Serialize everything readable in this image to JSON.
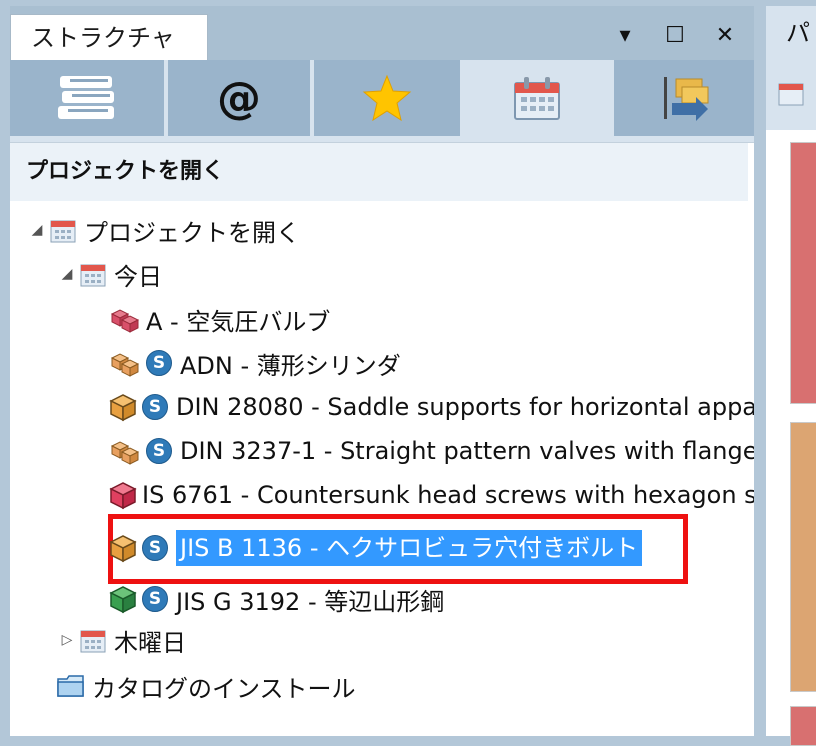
{
  "panel": {
    "title": "ストラクチャ",
    "window_controls": [
      "▾",
      "☐",
      "✕"
    ]
  },
  "toolbar": {
    "buttons": [
      {
        "icon": "books-icon"
      },
      {
        "icon": "at-icon",
        "label": "@"
      },
      {
        "icon": "star-icon"
      },
      {
        "icon": "calendar-icon"
      },
      {
        "icon": "import-icon"
      }
    ]
  },
  "section_header": "プロジェクトを開く",
  "tree": {
    "root": {
      "label": "プロジェクトを開く"
    },
    "today": {
      "label": "今日"
    },
    "items": [
      {
        "label": "A - 空気圧バルブ",
        "cube_color": "#d8506a",
        "has_s": false
      },
      {
        "label": "ADN - 薄形シリンダ",
        "cube_color": "#e8a060",
        "has_s": true
      },
      {
        "label": "DIN 28080 - Saddle supports for horizontal appa",
        "cube_color": "#e8a040",
        "has_s": true
      },
      {
        "label": "DIN 3237-1 - Straight pattern valves with flange",
        "cube_color": "#e8a060",
        "has_s": true
      },
      {
        "label": "IS 6761 - Countersunk head screws with hexagon s",
        "cube_color": "#e04060",
        "has_s": false
      },
      {
        "label": "JIS B 1136 - ヘクサロビュラ穴付きボルト",
        "cube_color": "#e8a040",
        "has_s": true,
        "selected": true
      },
      {
        "label": "JIS G 3192 - 等辺山形鋼",
        "cube_color": "#3aa050",
        "has_s": true
      }
    ],
    "thursday": {
      "label": "木曜日"
    },
    "install": {
      "label": "カタログのインストール"
    }
  },
  "right_panel": {
    "title": "パ"
  },
  "colors": {
    "accent": "#3399ff",
    "highlight_border": "#ee1111",
    "s_badge": "#2f7ab8"
  }
}
